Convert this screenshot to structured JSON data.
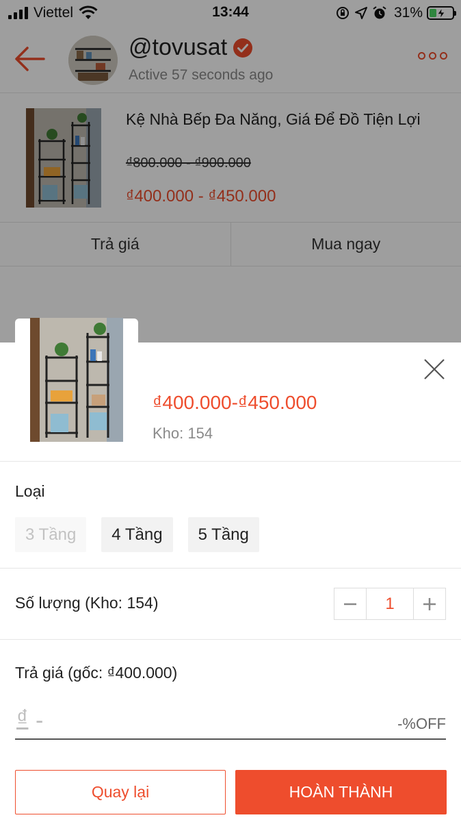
{
  "status_bar": {
    "carrier": "Viettel",
    "time": "13:44",
    "battery_percent": "31%",
    "battery_level": 0.31,
    "icons": [
      "signal-icon",
      "wifi-icon",
      "orientation-lock-icon",
      "location-icon",
      "alarm-icon",
      "battery-charging-icon"
    ]
  },
  "header": {
    "shop_name": "@tovusat",
    "active_status": "Active 57 seconds ago",
    "icons": [
      "back-arrow-icon",
      "verified-badge-icon",
      "more-icon"
    ]
  },
  "product_card": {
    "title": "Kệ Nhà Bếp Đa Năng, Giá Để Đồ Tiện Lợi",
    "original_price": "₫800.000 - ₫900.000",
    "price": "₫400.000 - ₫450.000",
    "actions": {
      "make_offer": "Trả giá",
      "buy_now": "Mua ngay"
    }
  },
  "sheet": {
    "price_range": "₫400.000-₫450.000",
    "stock": "Kho: 154",
    "variant_label": "Loại",
    "variants": [
      {
        "label": "3 Tầng",
        "available": false
      },
      {
        "label": "4 Tầng",
        "available": true
      },
      {
        "label": "5 Tầng",
        "available": true
      }
    ],
    "quantity_label": "Số lượng (Kho: 154)",
    "quantity": "1",
    "offer_label": "Trả giá (gốc: ₫400.000)",
    "offer_currency": "₫",
    "offer_placeholder": "-",
    "percent_off": "-%OFF",
    "back_button": "Quay lại",
    "done_button": "HOÀN THÀNH"
  },
  "colors": {
    "accent": "#ee4d2d",
    "muted_text": "#8a8a8a"
  }
}
